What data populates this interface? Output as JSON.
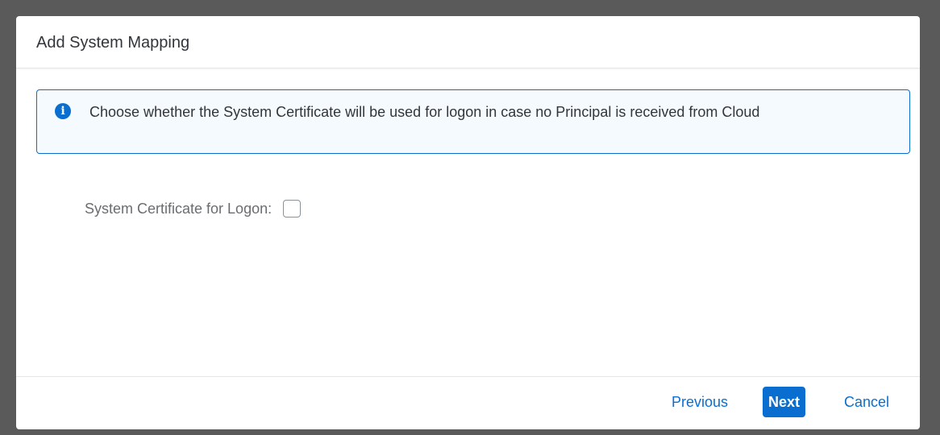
{
  "dialog": {
    "title": "Add System Mapping"
  },
  "info": {
    "icon": "info-icon",
    "message": "Choose whether the System Certificate will be used for logon in case no Principal is received from Cloud"
  },
  "form": {
    "system_certificate_label": "System Certificate for Logon:",
    "system_certificate_checked": false
  },
  "footer": {
    "previous_label": "Previous",
    "next_label": "Next",
    "cancel_label": "Cancel"
  },
  "colors": {
    "accent": "#0a6ed1",
    "backdrop": "#5a5a5a",
    "info_background": "#f5faff"
  }
}
